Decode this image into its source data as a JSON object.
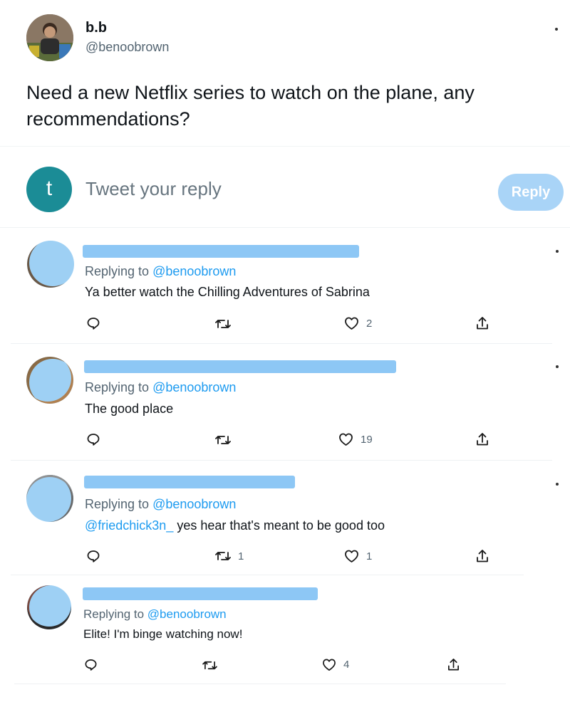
{
  "tweet": {
    "author_name": "b.b",
    "author_handle": "@benoobrown",
    "text": "Need a new Netflix series to watch on the plane, any recommendations?"
  },
  "compose": {
    "avatar_letter": "t",
    "placeholder": "Tweet your reply",
    "reply_button": "Reply"
  },
  "replies": [
    {
      "replying_prefix": "Replying to",
      "replying_handle": "@benoobrown",
      "mention": "",
      "text": "Ya better watch the Chilling Adventures of Sabrina",
      "retweets": "",
      "likes": "2"
    },
    {
      "replying_prefix": "Replying to",
      "replying_handle": "@benoobrown",
      "mention": "",
      "text": "The good place",
      "retweets": "",
      "likes": "19"
    },
    {
      "replying_prefix": "Replying to",
      "replying_handle": "@benoobrown",
      "mention": "@friedchick3n_",
      "text": " yes hear that's meant to be good too",
      "retweets": "1",
      "likes": "1"
    },
    {
      "replying_prefix": "Replying to",
      "replying_handle": "@benoobrown",
      "mention": "",
      "text": "Elite! I'm binge watching now!",
      "retweets": "",
      "likes": "4"
    }
  ],
  "icons": {
    "reply": "reply-icon",
    "retweet": "retweet-icon",
    "like": "heart-icon",
    "share": "share-icon"
  },
  "colors": {
    "link": "#1d9bf0",
    "reply_button": "#a9d4f7",
    "compose_avatar": "#1b8c96",
    "redaction": "#8dc7f5"
  }
}
